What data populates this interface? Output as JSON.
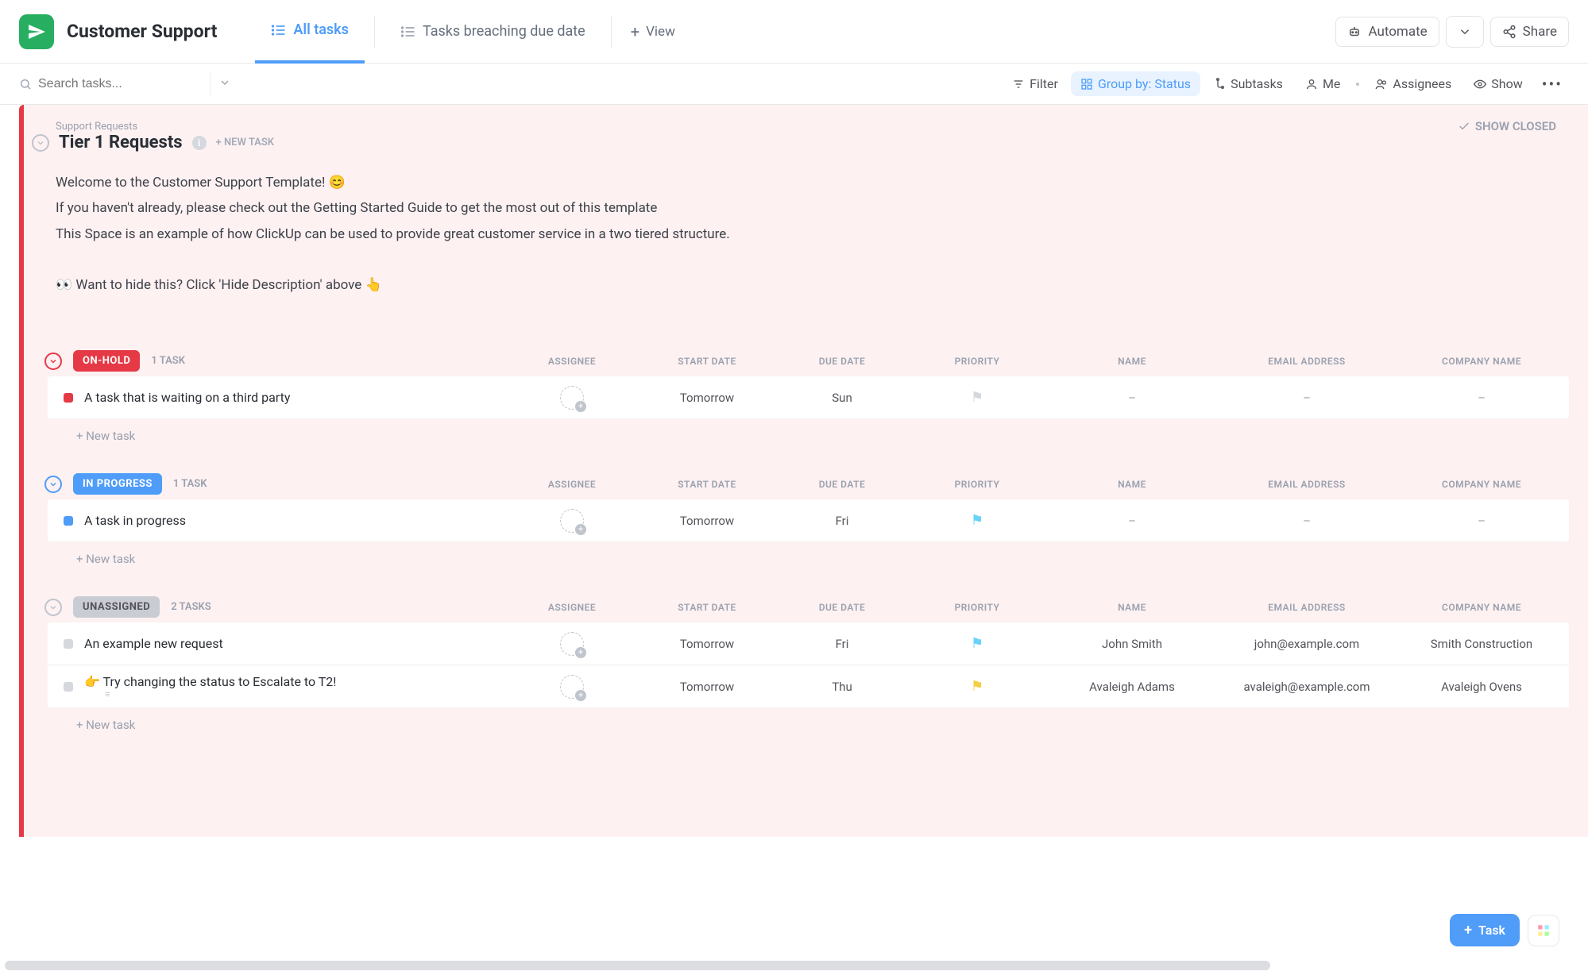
{
  "space": {
    "name": "Customer Support"
  },
  "tabs": [
    {
      "label": "All tasks",
      "active": true
    },
    {
      "label": "Tasks breaching due date",
      "active": false
    }
  ],
  "view_add": "View",
  "header_buttons": {
    "automate": "Automate",
    "share": "Share"
  },
  "search": {
    "placeholder": "Search tasks..."
  },
  "toolbar": {
    "filter": "Filter",
    "group_by": "Group by: Status",
    "subtasks": "Subtasks",
    "me": "Me",
    "assignees": "Assignees",
    "show": "Show"
  },
  "list": {
    "folder": "Support Requests",
    "title": "Tier 1 Requests",
    "new_task": "+ NEW TASK",
    "show_closed": "SHOW CLOSED",
    "description": {
      "l1": "Welcome to the Customer Support Template! 😊",
      "l2": "If you haven't already, please check out the Getting Started Guide to get the most out of this template",
      "l3": "This Space is an example of how ClickUp can be used to provide great customer service in a two tiered structure.",
      "l4": "👀 Want to hide this? Click 'Hide Description' above 👆"
    }
  },
  "columns": {
    "assignee": "ASSIGNEE",
    "start": "START DATE",
    "due": "DUE DATE",
    "priority": "PRIORITY",
    "name": "NAME",
    "email": "EMAIL ADDRESS",
    "company": "COMPANY NAME"
  },
  "groups": [
    {
      "status": "ON-HOLD",
      "pill_class": "pill-red",
      "circle_class": "red",
      "count": "1 TASK",
      "tasks": [
        {
          "sq": "sq-red",
          "title": "A task that is waiting on a third party",
          "start": "Tomorrow",
          "due": "Sun",
          "flag": "gray",
          "name": "–",
          "email": "–",
          "company": "–"
        }
      ],
      "new_task": "+ New task"
    },
    {
      "status": "IN PROGRESS",
      "pill_class": "pill-blue",
      "circle_class": "blue",
      "count": "1 TASK",
      "tasks": [
        {
          "sq": "sq-blue",
          "title": "A task in progress",
          "start": "Tomorrow",
          "due": "Fri",
          "flag": "cyan",
          "name": "–",
          "email": "–",
          "company": "–"
        }
      ],
      "new_task": "+ New task"
    },
    {
      "status": "UNASSIGNED",
      "pill_class": "pill-gray",
      "circle_class": "gray",
      "count": "2 TASKS",
      "tasks": [
        {
          "sq": "sq-lgray",
          "title": "An example new request",
          "start": "Tomorrow",
          "due": "Fri",
          "flag": "cyan",
          "name": "John Smith",
          "email": "john@example.com",
          "company": "Smith Construction"
        },
        {
          "sq": "sq-lgray",
          "title": "👉 Try changing the status to Escalate to T2!",
          "start": "Tomorrow",
          "due": "Thu",
          "flag": "yellow",
          "name": "Avaleigh Adams",
          "email": "avaleigh@example.com",
          "company": "Avaleigh Ovens",
          "sub": true
        }
      ],
      "new_task": "+ New task"
    }
  ],
  "fab": {
    "task": "Task"
  }
}
